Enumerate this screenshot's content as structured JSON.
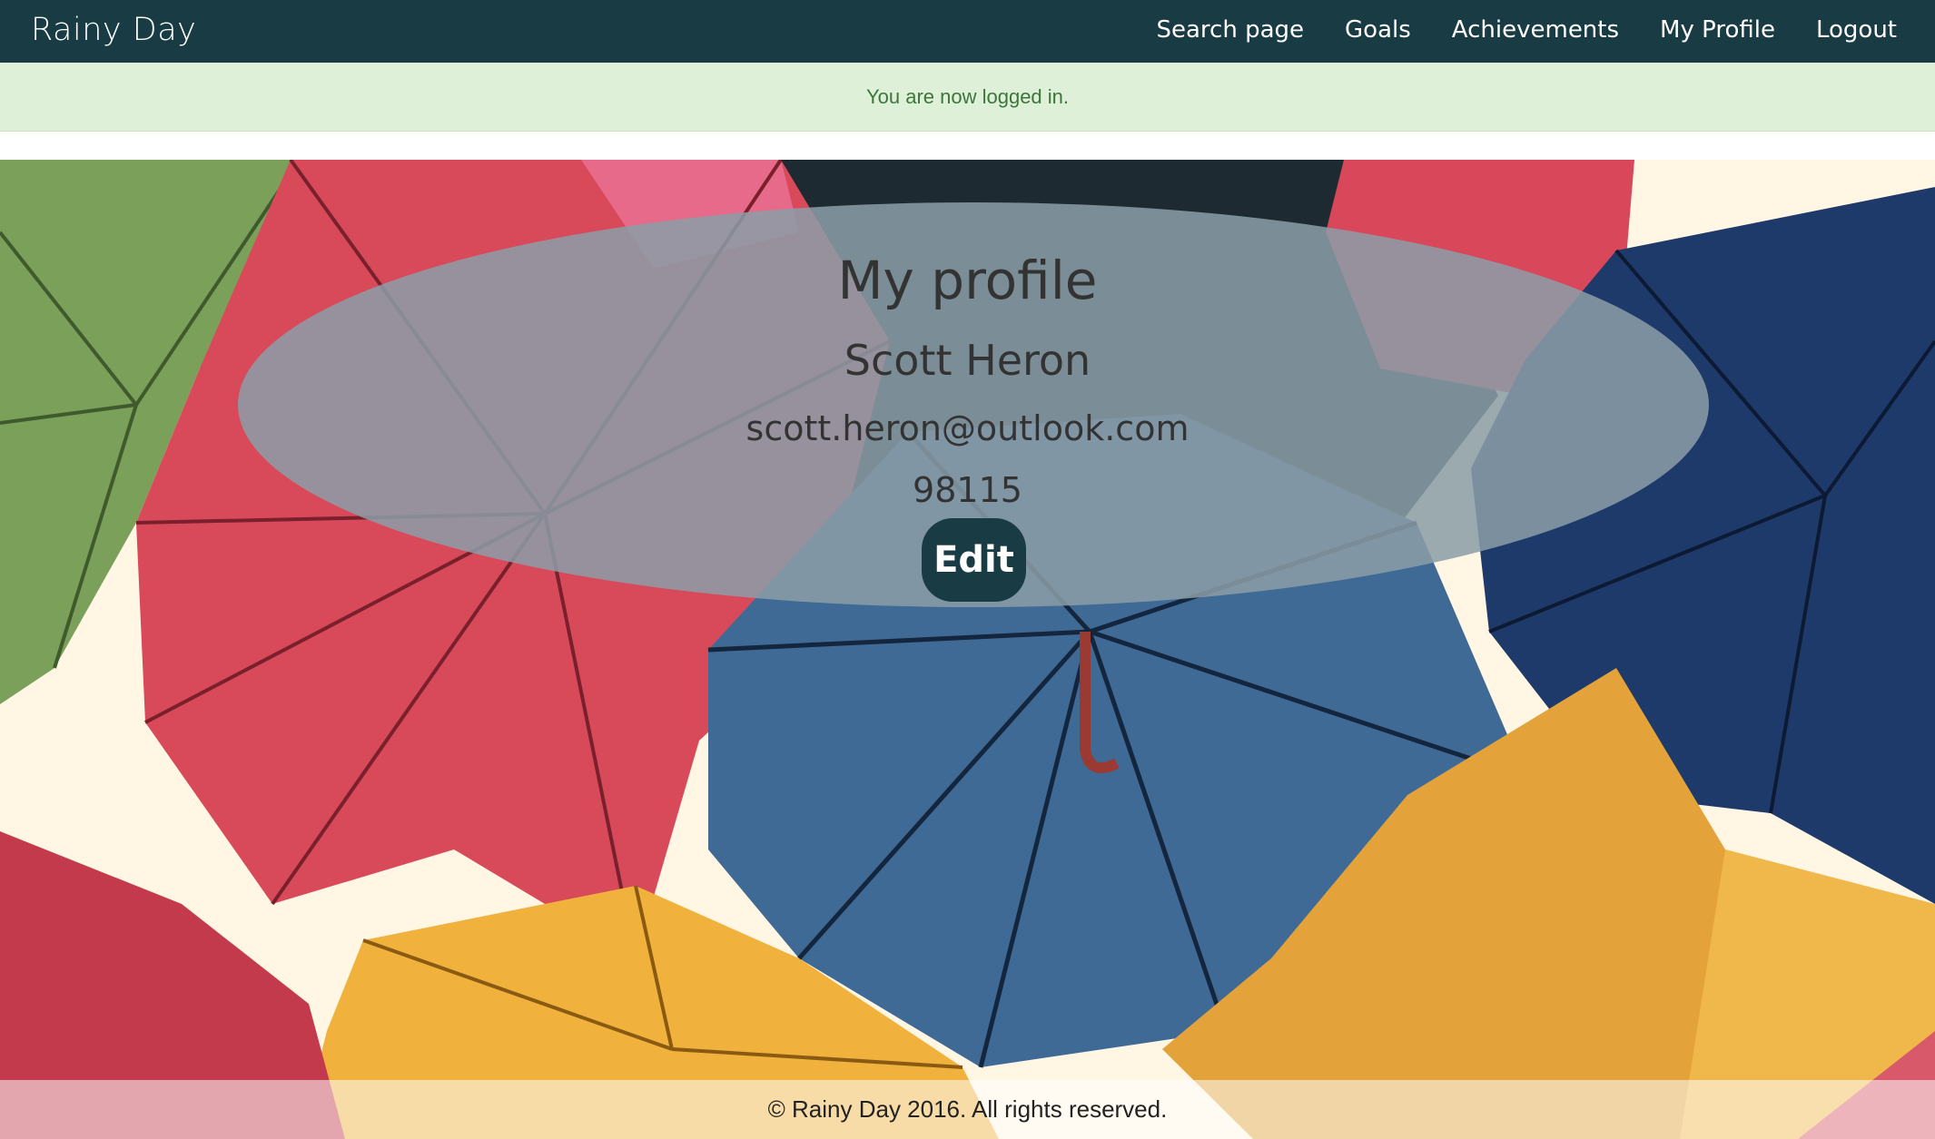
{
  "navbar": {
    "brand": "Rainy Day",
    "links": [
      {
        "label": "Search page"
      },
      {
        "label": "Goals"
      },
      {
        "label": "Achievements"
      },
      {
        "label": "My Profile"
      },
      {
        "label": "Logout"
      }
    ]
  },
  "alert": {
    "message": "You are now logged in."
  },
  "profile": {
    "title": "My profile",
    "name": "Scott Heron",
    "email": "scott.heron@outlook.com",
    "zip": "98115",
    "edit_label": "Edit"
  },
  "footer": {
    "text": "© Rainy Day 2016. All rights reserved."
  },
  "colors": {
    "navbar": "#193c44",
    "alert_bg": "#dff0d8",
    "alert_text": "#3c763d",
    "panel": "#8b9da6",
    "button": "#193c44"
  }
}
